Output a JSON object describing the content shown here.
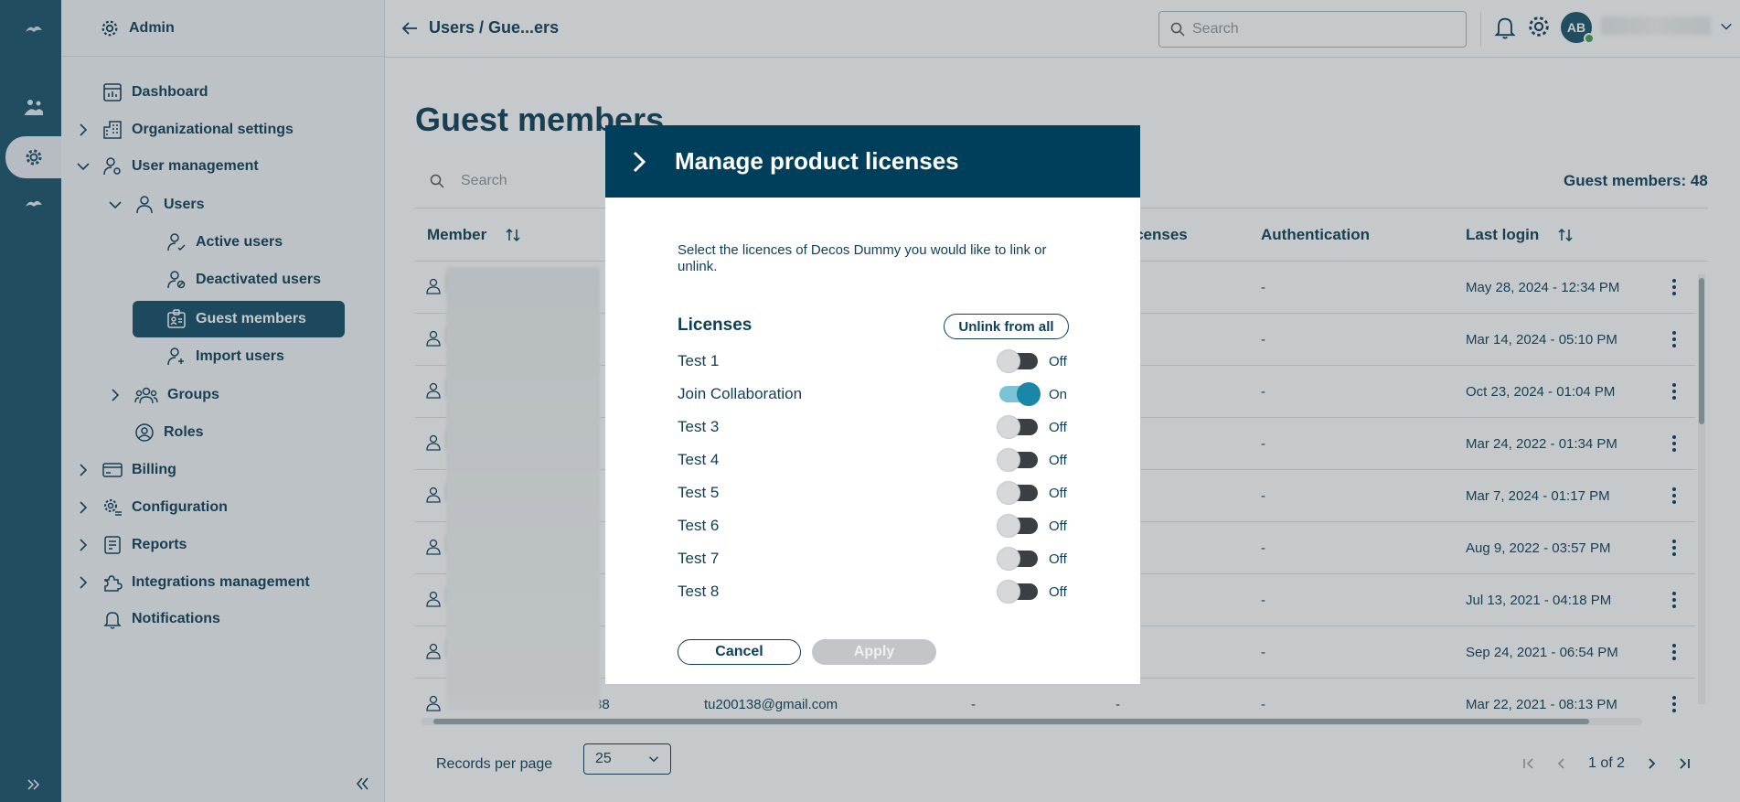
{
  "sidebar": {
    "header": "Admin",
    "items": [
      {
        "label": "Dashboard"
      },
      {
        "label": "Organizational settings"
      },
      {
        "label": "User management"
      },
      {
        "label": "Users"
      },
      {
        "label": "Active users"
      },
      {
        "label": "Deactivated users"
      },
      {
        "label": "Guest members"
      },
      {
        "label": "Import users"
      },
      {
        "label": "Groups"
      },
      {
        "label": "Roles"
      },
      {
        "label": "Billing"
      },
      {
        "label": "Configuration"
      },
      {
        "label": "Reports"
      },
      {
        "label": "Integrations management"
      },
      {
        "label": "Notifications"
      }
    ]
  },
  "topbar": {
    "breadcrumb": "Users / Gue...ers",
    "search_placeholder": "Search",
    "avatar_initials": "AB"
  },
  "main": {
    "title": "Guest members",
    "search_placeholder": "Search",
    "count_label": "Guest members: 48",
    "columns": {
      "member": "Member",
      "licenses": "Licenses",
      "authentication": "Authentication",
      "last_login": "Last login"
    },
    "rows": [
      {
        "auth": "-",
        "last_login": "May 28, 2024 - 12:34 PM"
      },
      {
        "auth": "-",
        "last_login": "Mar 14, 2024 - 05:10 PM"
      },
      {
        "auth": "-",
        "last_login": "Oct 23, 2024 - 01:04 PM"
      },
      {
        "auth": "-",
        "last_login": "Mar 24, 2022 - 01:34 PM"
      },
      {
        "auth": "-",
        "last_login": "Mar 7, 2024 - 01:17 PM"
      },
      {
        "auth": "-",
        "last_login": "Aug 9, 2022 - 03:57 PM"
      },
      {
        "auth": "-",
        "last_login": "Jul 13, 2021 - 04:18 PM"
      },
      {
        "auth": "-",
        "last_login": "Sep 24, 2021 - 06:54 PM"
      },
      {
        "id_suffix": "38",
        "email": "tu200138@gmail.com",
        "col3": "-",
        "licenses": "-",
        "auth": "-",
        "last_login": "Mar 22, 2021 - 08:13 PM"
      }
    ]
  },
  "footer": {
    "records_label": "Records per page",
    "records_value": "25",
    "page_info": "1 of 2"
  },
  "modal": {
    "title": "Manage product licenses",
    "description": "Select the licences of Decos Dummy you would like to link or unlink.",
    "licenses_heading": "Licenses",
    "unlink_label": "Unlink from all",
    "licenses": [
      {
        "name": "Test 1",
        "state": "Off"
      },
      {
        "name": "Join Collaboration",
        "state": "On"
      },
      {
        "name": "Test 3",
        "state": "Off"
      },
      {
        "name": "Test 4",
        "state": "Off"
      },
      {
        "name": "Test 5",
        "state": "Off"
      },
      {
        "name": "Test 6",
        "state": "Off"
      },
      {
        "name": "Test 7",
        "state": "Off"
      },
      {
        "name": "Test 8",
        "state": "Off"
      }
    ],
    "cancel_label": "Cancel",
    "apply_label": "Apply"
  },
  "colors": {
    "brand": "#003f5c",
    "rail": "#1b546c",
    "toggle_on": "#1a87a8",
    "status_online": "#3fa34d"
  }
}
